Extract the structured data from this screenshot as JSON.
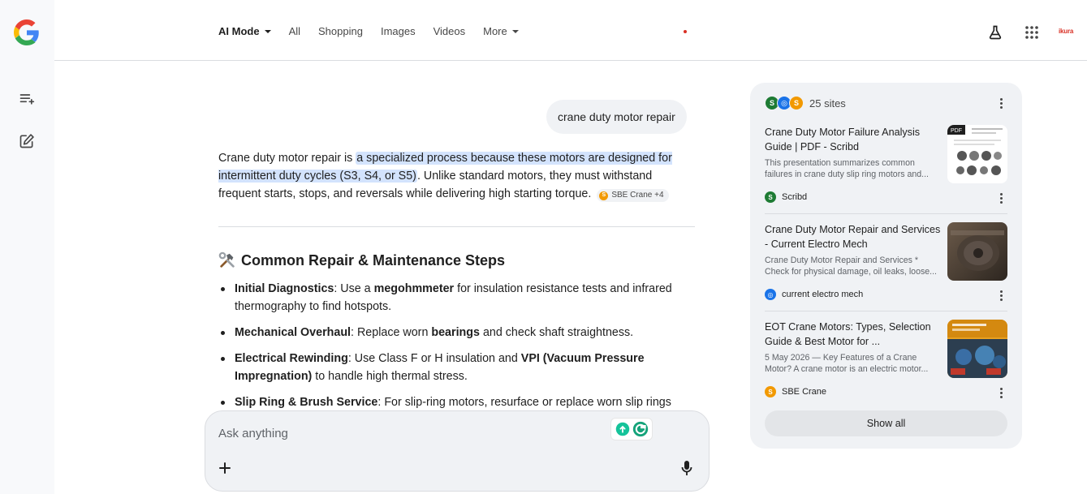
{
  "header": {
    "tabs": [
      {
        "label": "AI Mode",
        "active": true,
        "dropdown": true
      },
      {
        "label": "All"
      },
      {
        "label": "Shopping"
      },
      {
        "label": "Images"
      },
      {
        "label": "Videos"
      },
      {
        "label": "More",
        "dropdown": true
      }
    ],
    "avatar_text": "ikura",
    "icons": [
      "labs-flask-icon",
      "apps-grid-icon"
    ]
  },
  "rail": {
    "icons": [
      "google-logo",
      "history-list-icon",
      "new-chat-icon"
    ]
  },
  "conversation": {
    "user_query": "crane duty motor repair",
    "answer": {
      "lead": "Crane duty motor repair is ",
      "highlight": "a specialized process because these motors are designed for intermittent duty cycles (S3, S4, or S5)",
      "rest": ". Unlike standard motors, they must withstand frequent starts, stops, and reversals while delivering high starting torque.",
      "citation_chip": "SBE Crane +4"
    },
    "section_title": "Common Repair & Maintenance Steps",
    "steps": [
      {
        "term": "Initial Diagnostics",
        "pre": ": Use a ",
        "strong": "megohmmeter",
        "post": " for insulation resistance tests and infrared thermography to find hotspots."
      },
      {
        "term": "Mechanical Overhaul",
        "pre": ": Replace worn ",
        "strong": "bearings",
        "post": " and check shaft straightness."
      },
      {
        "term": "Electrical Rewinding",
        "pre": ": Use Class F or H insulation and ",
        "strong": "VPI (Vacuum Pressure Impregnation)",
        "post": " to handle high thermal stress."
      },
      {
        "term": "Slip Ring & Brush Service",
        "pre": ": For slip-ring motors, resurface or replace worn slip rings",
        "strong": "",
        "post": ""
      }
    ]
  },
  "composer": {
    "placeholder": "Ask anything",
    "value": ""
  },
  "sources": {
    "count_label": "25 sites",
    "items": [
      {
        "title": "Crane Duty Motor Failure Analysis Guide | PDF - Scribd",
        "snippet": "This presentation summarizes common failures in crane duty slip ring motors and...",
        "site": "Scribd",
        "badge": "PDF",
        "favicon_color": "#1e7b34"
      },
      {
        "title": "Crane Duty Motor Repair and Services - Current Electro Mech",
        "snippet": "Crane Duty Motor Repair and Services * Check for physical damage, oil leaks, loose...",
        "site": "current electro mech",
        "favicon_color": "#1a73e8"
      },
      {
        "title": "EOT Crane Motors: Types, Selection Guide & Best Motor for ...",
        "snippet": "5 May 2026 — Key Features of a Crane Motor? A crane motor is an electric motor...",
        "site": "SBE Crane",
        "favicon_color": "#f29900"
      }
    ],
    "show_all_label": "Show all"
  },
  "colors": {
    "highlight": "#d3e3fd",
    "panel_bg": "#f0f2f5",
    "accent_red": "#d93025"
  }
}
